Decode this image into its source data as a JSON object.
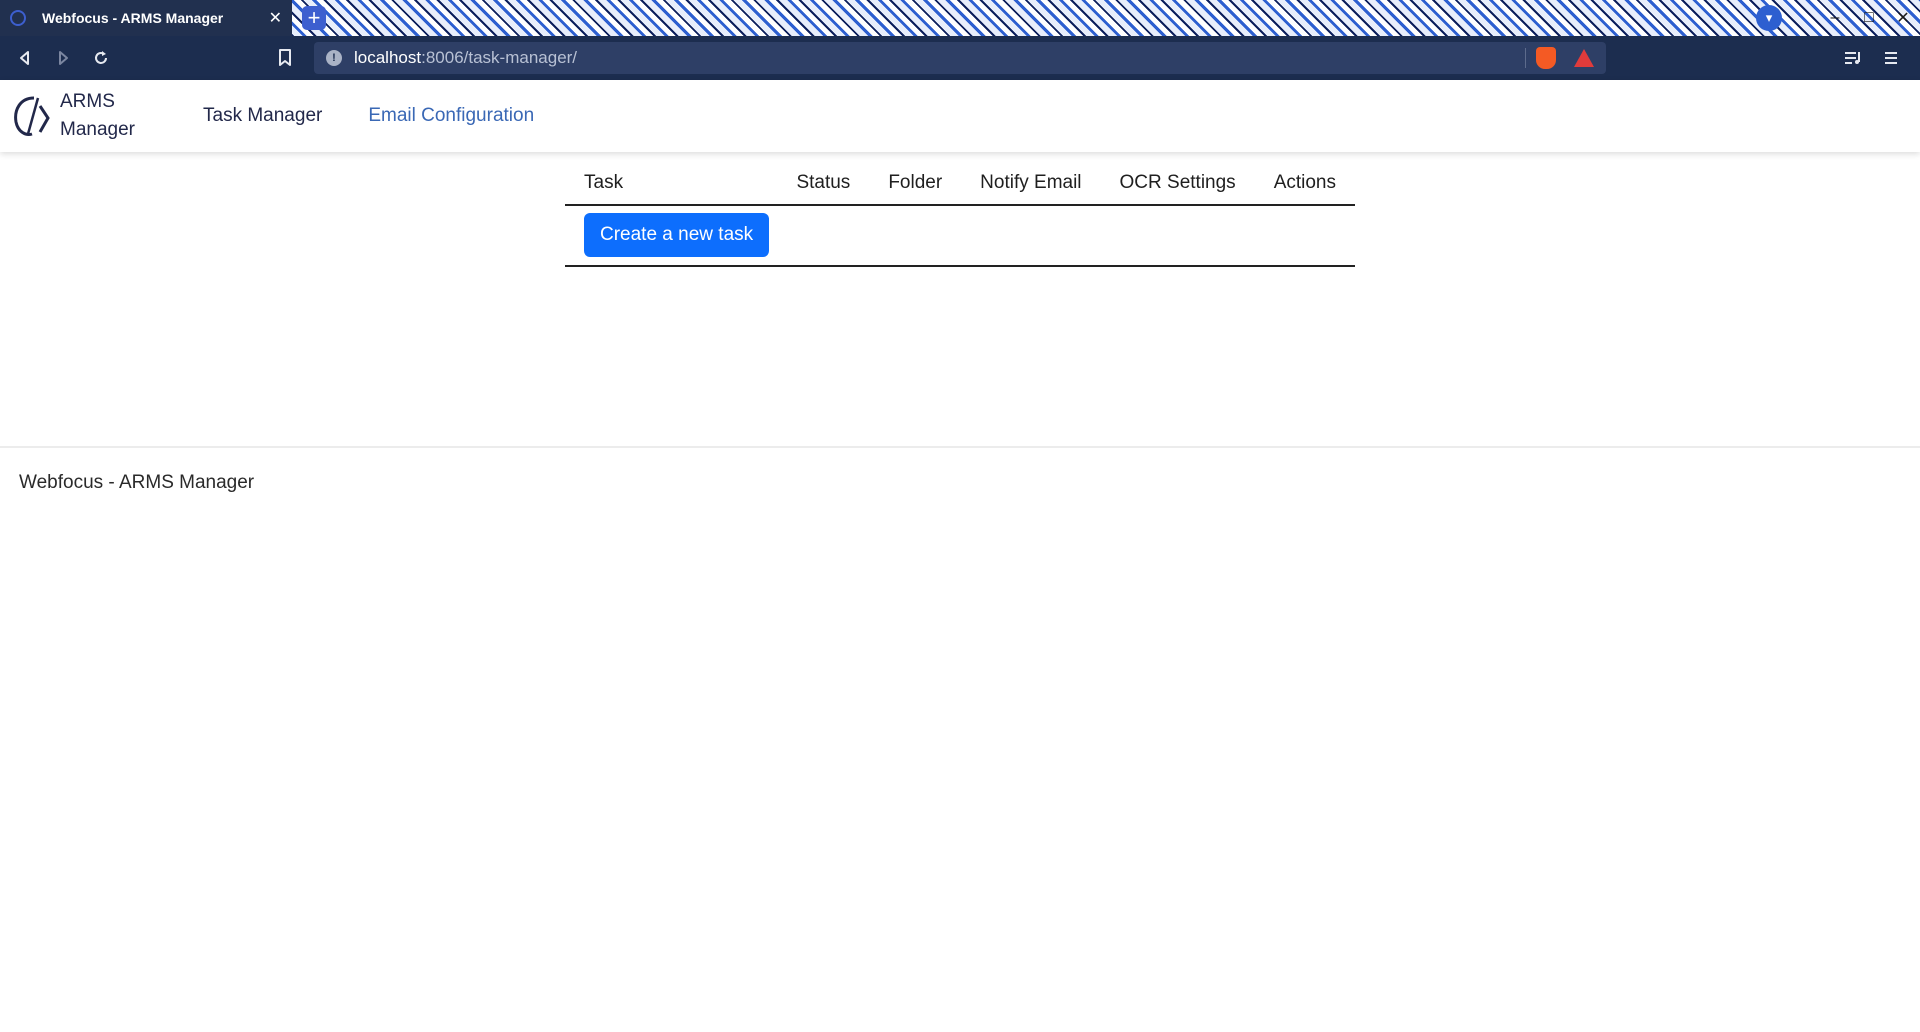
{
  "browser": {
    "tab_title": "Webfocus - ARMS Manager",
    "tab_close": "✕",
    "new_tab": "+",
    "url_host": "localhost",
    "url_rest": ":8006/task-manager/",
    "icons": {
      "back": "back-icon",
      "forward": "forward-icon",
      "reload": "reload-icon",
      "bookmark": "bookmark-icon",
      "site_info": "info-icon",
      "shields": "brave-shields-icon",
      "rewards": "brave-rewards-icon",
      "playlist": "playlist-icon",
      "menu": "menu-icon",
      "minimize": "minimize-icon",
      "maximize": "maximize-icon",
      "close": "close-icon"
    },
    "window_controls": {
      "minimize": "–",
      "maximize": "□",
      "close": "✕"
    }
  },
  "app": {
    "brand_line1": "ARMS",
    "brand_line2": "Manager",
    "nav": {
      "task_manager": "Task Manager",
      "email_configuration": "Email Configuration"
    },
    "colors": {
      "primary_button": "#0d6efd",
      "nav_active_link": "#3a68b5",
      "brand_text": "#22284a"
    }
  },
  "table": {
    "columns": [
      "Task",
      "Status",
      "Folder",
      "Notify Email",
      "OCR Settings",
      "Actions"
    ],
    "create_button": "Create a new task"
  },
  "footer": {
    "text": "Webfocus - ARMS Manager"
  }
}
